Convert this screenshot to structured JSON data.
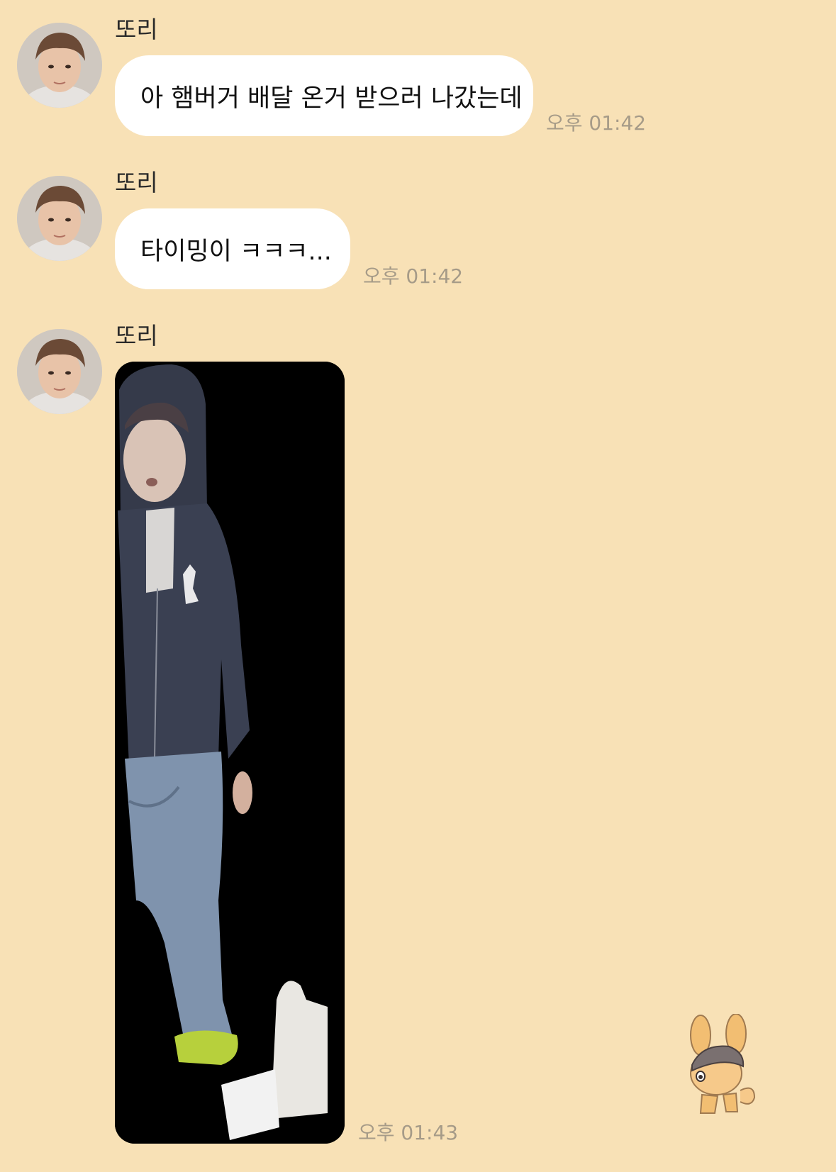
{
  "sender": "또리",
  "messages": [
    {
      "sender": "또리",
      "type": "text",
      "text": "아 햄버거 배달 온거 받으러 나갔는데",
      "time": "오후 01:42"
    },
    {
      "sender": "또리",
      "type": "text",
      "text": "타이밍이 ㅋㅋㅋ...",
      "time": "오후 01:42"
    },
    {
      "sender": "또리",
      "type": "image",
      "time": "오후 01:43"
    }
  ],
  "colors": {
    "background": "#f8e1b6",
    "bubble": "#ffffff",
    "timestamp": "#a69b88",
    "photo_background": "#000000"
  },
  "icons": {
    "avatar": "profile-photo",
    "sticker": "rabbit-character-sticker"
  }
}
